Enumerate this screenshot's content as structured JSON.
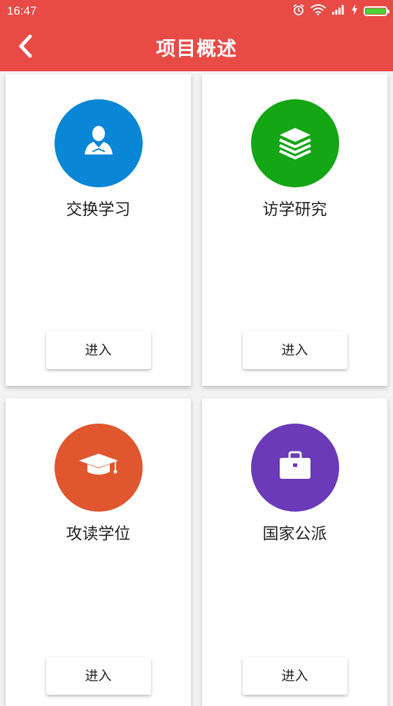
{
  "status_bar": {
    "time": "16:47",
    "icons": [
      "alarm-icon",
      "wifi-icon",
      "signal-icon",
      "charging-icon",
      "battery-icon"
    ],
    "battery_level": 1.0
  },
  "header": {
    "title": "项目概述",
    "back_icon": "chevron-left-icon",
    "background_color": "#e84a46"
  },
  "cards": [
    {
      "label": "交换学习",
      "button_label": "进入",
      "icon": "student-icon",
      "color": "#0a86d6"
    },
    {
      "label": "访学研究",
      "button_label": "进入",
      "icon": "stack-layers-icon",
      "color": "#14a614"
    },
    {
      "label": "攻读学位",
      "button_label": "进入",
      "icon": "graduation-cap-icon",
      "color": "#e0562f"
    },
    {
      "label": "国家公派",
      "button_label": "进入",
      "icon": "briefcase-icon",
      "color": "#6a3ab8"
    }
  ]
}
